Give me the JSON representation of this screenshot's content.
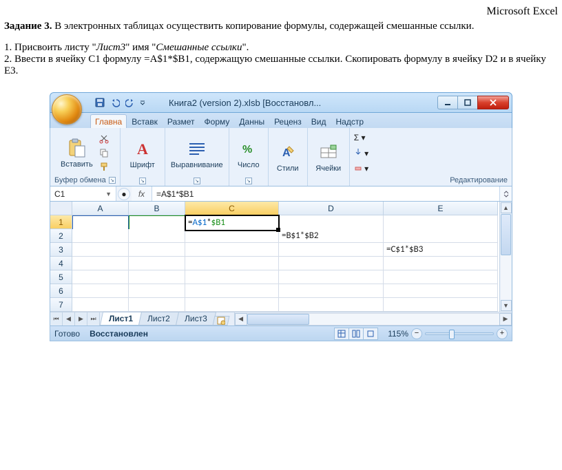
{
  "doc": {
    "app": "Microsoft Excel",
    "task_label": "Задание 3.",
    "task_text": " В электронных таблицах осуществить копирование формулы, содержащей смешанные ссылки.",
    "step1_a": "1. Присвоить листу \"",
    "step1_em1": "Лист3",
    "step1_b": "\" имя \"",
    "step1_em2": "Смешанные ссылки",
    "step1_c": "\".",
    "step2": "2. Ввести в ячейку C1 формулу =A$1*$B1, содержащую смешанные ссылки. Скопировать формулу в ячейку D2 и в ячейку E3."
  },
  "window": {
    "title": "Книга2 (version 2).xlsb [Восстановл...",
    "tabs": [
      "Главна",
      "Вставк",
      "Размет",
      "Форму",
      "Данны",
      "Реценз",
      "Вид",
      "Надстр"
    ],
    "groups": {
      "clipboard": "Буфер обмена",
      "paste": "Вставить",
      "font": "Шрифт",
      "align": "Выравнивание",
      "number": "Число",
      "styles": "Стили",
      "cells": "Ячейки",
      "editing": "Редактирование"
    },
    "namebox": "C1",
    "formula": "=A$1*$B1",
    "columns": [
      "A",
      "B",
      "C",
      "D",
      "E"
    ],
    "rows": [
      "1",
      "2",
      "3",
      "4",
      "5",
      "6",
      "7"
    ],
    "cells": {
      "c1": "=A$1*$B1",
      "d2": "=B$1*$B2",
      "e3": "=C$1*$B3"
    },
    "sheets": [
      "Лист1",
      "Лист2",
      "Лист3"
    ],
    "status_ready": "Готово",
    "status_recovered": "Восстановлен",
    "zoom": "115%"
  }
}
